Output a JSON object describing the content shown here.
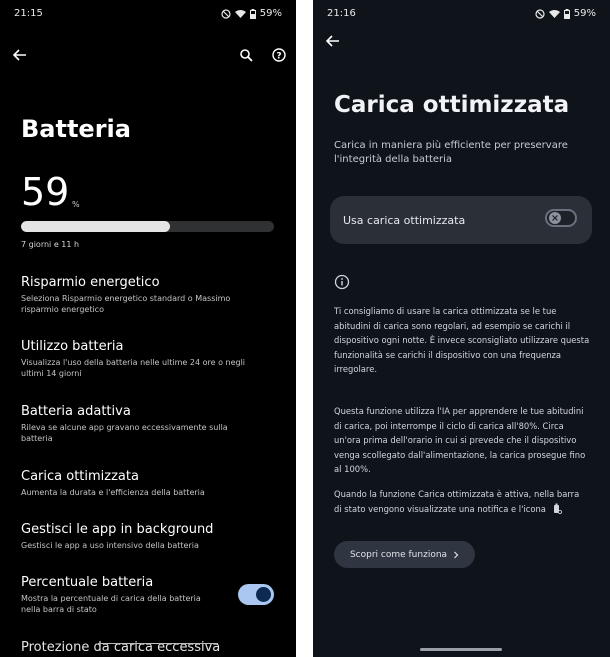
{
  "left": {
    "status": {
      "time": "21:15",
      "battery": "59%"
    },
    "toolbar": {
      "back_icon": "arrow-left-icon",
      "search_icon": "search-icon",
      "help_icon": "help-icon"
    },
    "title": "Batteria",
    "battery_level": "59",
    "percent_sign": "%",
    "battery_fill_percent": 59,
    "remaining": "7 giorni e 11 h",
    "items": [
      {
        "title": "Risparmio energetico",
        "desc": "Seleziona Risparmio energetico standard o Massimo risparmio energetico"
      },
      {
        "title": "Utilizzo batteria",
        "desc": "Visualizza l'uso della batteria nelle ultime 24 ore o negli ultimi 14 giorni"
      },
      {
        "title": "Batteria adattiva",
        "desc": "Rileva se alcune app gravano eccessivamente sulla batteria"
      },
      {
        "title": "Carica ottimizzata",
        "desc": "Aumenta la durata e l'efficienza della batteria"
      },
      {
        "title": "Gestisci le app in background",
        "desc": "Gestisci le app a uso intensivo della batteria"
      },
      {
        "title": "Percentuale batteria",
        "desc": "Mostra la percentuale di carica della batteria nella barra di stato",
        "toggle_on": true
      },
      {
        "title": "Protezione da carica eccessiva",
        "desc": ""
      }
    ]
  },
  "right": {
    "status": {
      "time": "21:16",
      "battery": "59%"
    },
    "toolbar": {
      "back_icon": "arrow-left-icon"
    },
    "title": "Carica ottimizzata",
    "subtitle": "Carica in maniera più efficiente per preservare l'integrità della batteria",
    "toggle_card": {
      "label": "Usa carica ottimizzata",
      "on": false
    },
    "info_icon": "info-icon",
    "paragraph1": "Ti consigliamo di usare la carica ottimizzata se le tue abitudini di carica sono regolari, ad esempio se carichi il dispositivo ogni notte. È invece sconsigliato utilizzare questa funzionalità se carichi il dispositivo con una frequenza irregolare.",
    "paragraph2": "Questa funzione utilizza l'IA per apprendere le tue abitudini di carica, poi interrompe il ciclo di carica all'80%. Circa un'ora prima dell'orario in cui si prevede che il dispositivo venga scollegato dall'alimentazione, la carica prosegue fino al 100%.",
    "paragraph3": "Quando la funzione Carica ottimizzata è attiva, nella barra di stato vengono visualizzate una notifica e l'icona",
    "learn_more_button": "Scopri come funziona"
  },
  "colors": {
    "toggle_on_track": "#a9c7f0",
    "toggle_on_knob": "#0c2a52",
    "right_background": "#0f141b",
    "card_background": "#2b3038"
  }
}
